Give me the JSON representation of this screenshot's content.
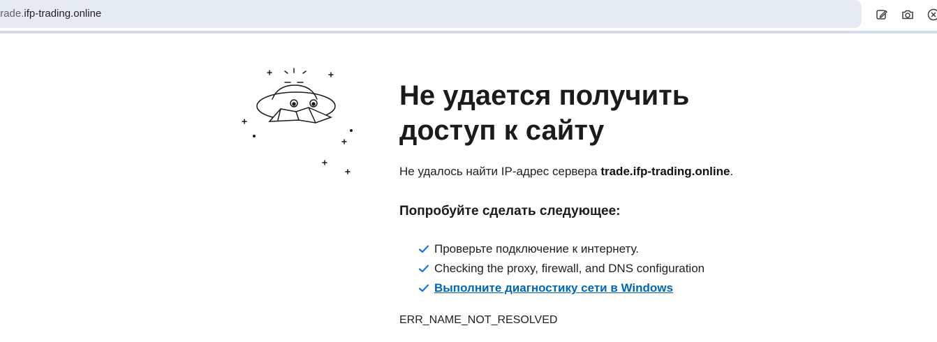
{
  "browser": {
    "url_host": "trade.",
    "url_rest": "ifp-trading.online",
    "icons": [
      "edit-icon",
      "camera-icon",
      "close-circle-icon"
    ]
  },
  "error_page": {
    "title": "Не удается получить доступ к сайту",
    "message_prefix": "Не удалось найти IP-адрес сервера ",
    "message_host": "trade.ifp-trading.online",
    "message_suffix": ".",
    "try_heading": "Попробуйте сделать следующее:",
    "suggestions": [
      "Проверьте подключение к интернету.",
      "Checking the proxy, firewall, and DNS configuration",
      "Выполните диагностику сети в Windows"
    ],
    "error_code": "ERR_NAME_NOT_RESOLVED"
  },
  "colors": {
    "accent": "#0067b8",
    "check": "#1a73e8",
    "address_bar_bg": "#e6ebf2"
  }
}
